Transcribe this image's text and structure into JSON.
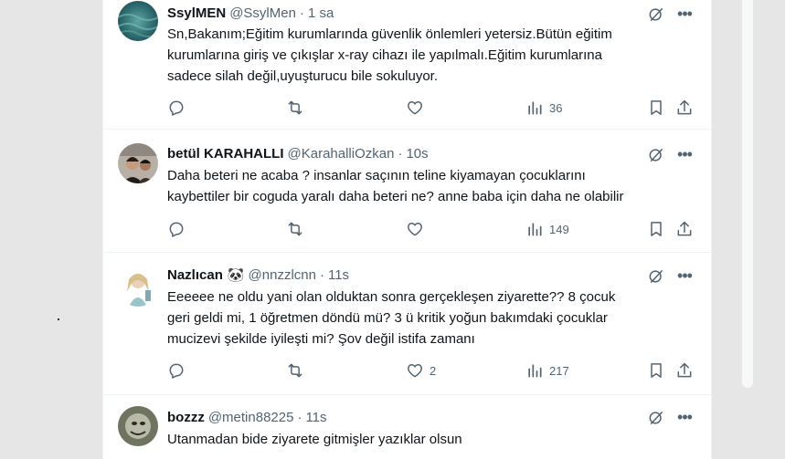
{
  "tweets": [
    {
      "name": "SsylMEN",
      "handle": "@SsylMen",
      "time": "1 sa",
      "emoji": "",
      "lines": [
        "Sn,Bakanım;Eğitim kurumlarında güvenlik önlemleri yetersiz.Bütün eğitim",
        "kurumlarına giriş ve çıkışlar x-ray cihazı ile yapılmalı.Eğitim kurumlarına",
        "sadece silah değil,uyuşturucu bile sokuluyor."
      ],
      "likes": "",
      "views": "36"
    },
    {
      "name": "betül KARAHALLI",
      "handle": "@KarahalliOzkan",
      "time": "10s",
      "emoji": "",
      "lines": [
        "Daha beteri ne acaba ? insanlar saçının teline kiyamayan çocuklarını",
        "kaybettiler bir coguda yaralı daha beteri ne? anne baba için daha ne olabilir"
      ],
      "likes": "",
      "views": "149"
    },
    {
      "name": "Nazlıcan",
      "handle": "@nnzzlcnn",
      "time": "11s",
      "emoji": "🐼",
      "lines": [
        "Eeeeee ne oldu yani olan olduktan sonra gerçekleşen ziyarette?? 8 çocuk",
        "geri geldi mi, 1 öğretmen döndü mü? 3 ü kritik yoğun bakımdaki çocuklar",
        "mucizevi şekilde iyileşti mi? Şov değil istifa zamanı"
      ],
      "likes": "2",
      "views": "217"
    },
    {
      "name": "bozzz",
      "handle": "@metin88225",
      "time": "11s",
      "emoji": "",
      "lines": [
        "Utanmadan bide ziyarete gitmişler yazıklar olsun"
      ],
      "likes": "",
      "views": ""
    }
  ],
  "icons": {
    "reply": "reply-icon",
    "retweet": "retweet-icon",
    "like": "heart-icon",
    "views": "views-icon",
    "bookmark": "bookmark-icon",
    "share": "share-icon",
    "grok": "grok-icon",
    "more": "more-icon"
  },
  "colors": {
    "text": "#0f1419",
    "secondary": "#536471",
    "divider": "#eff3f4"
  }
}
